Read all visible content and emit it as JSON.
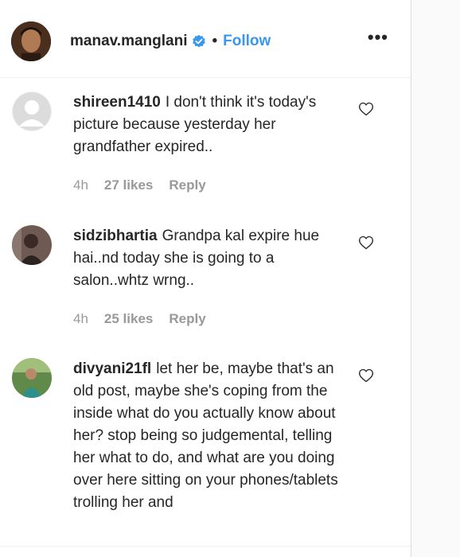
{
  "post": {
    "username": "manav.manglani",
    "separator": "•",
    "follow_label": "Follow",
    "more_label": "•••"
  },
  "icons": {
    "verified": "verified-badge-icon",
    "heart": "heart-outline-icon",
    "more": "more-options-icon"
  },
  "colors": {
    "accent": "#3897f0",
    "meta_text": "#999999",
    "text": "#262626",
    "verified_badge": "#3897f0"
  },
  "comments": [
    {
      "username": "shireen1410",
      "text": "I don't think it's today's picture because yesterday her grandfather expired..",
      "time": "4h",
      "likes": "27 likes",
      "reply_label": "Reply"
    },
    {
      "username": "sidzibhartia",
      "text": "Grandpa kal expire hue hai..nd today she is going to a salon..whtz wrng..",
      "time": "4h",
      "likes": "25 likes",
      "reply_label": "Reply"
    },
    {
      "username": "divyani21fl",
      "text": "let her be, maybe that's an old post, maybe she's coping from the inside what do you actually know about her? stop being so judgemental, telling her what to do, and what are you doing over here sitting on your phones/tablets trolling her and",
      "time": "",
      "likes": "",
      "reply_label": ""
    }
  ]
}
